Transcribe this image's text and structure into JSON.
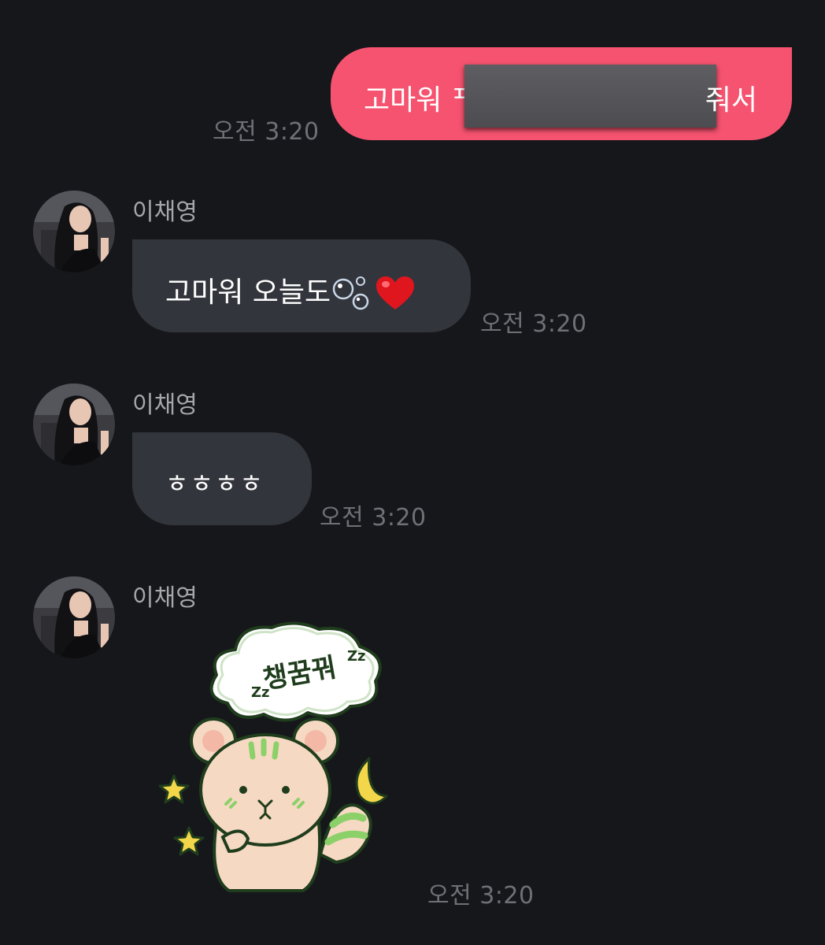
{
  "messages": {
    "sent": {
      "text_visible_start": "고마워 ᄑ",
      "text_visible_end": "줘서",
      "time": "오전 3:20"
    },
    "received": [
      {
        "sender": "이채영",
        "text": "고마워 오늘도",
        "emojis": [
          "bubbles-emoji",
          "red-heart-emoji"
        ],
        "time": "오전 3:20"
      },
      {
        "sender": "이채영",
        "text": "ㅎㅎㅎㅎ",
        "time": "오전 3:20"
      },
      {
        "sender": "이채영",
        "sticker": {
          "caption": "챙꿈꿔",
          "zz": "Zz",
          "description": "sleepy peach squirrel sticker"
        },
        "time": "오전 3:20"
      }
    ]
  },
  "colors": {
    "background": "#16171b",
    "sent_bubble": "#f5536f",
    "received_bubble": "#33353c",
    "timestamp": "#6f7076",
    "sender_name": "#a6a7ab"
  }
}
